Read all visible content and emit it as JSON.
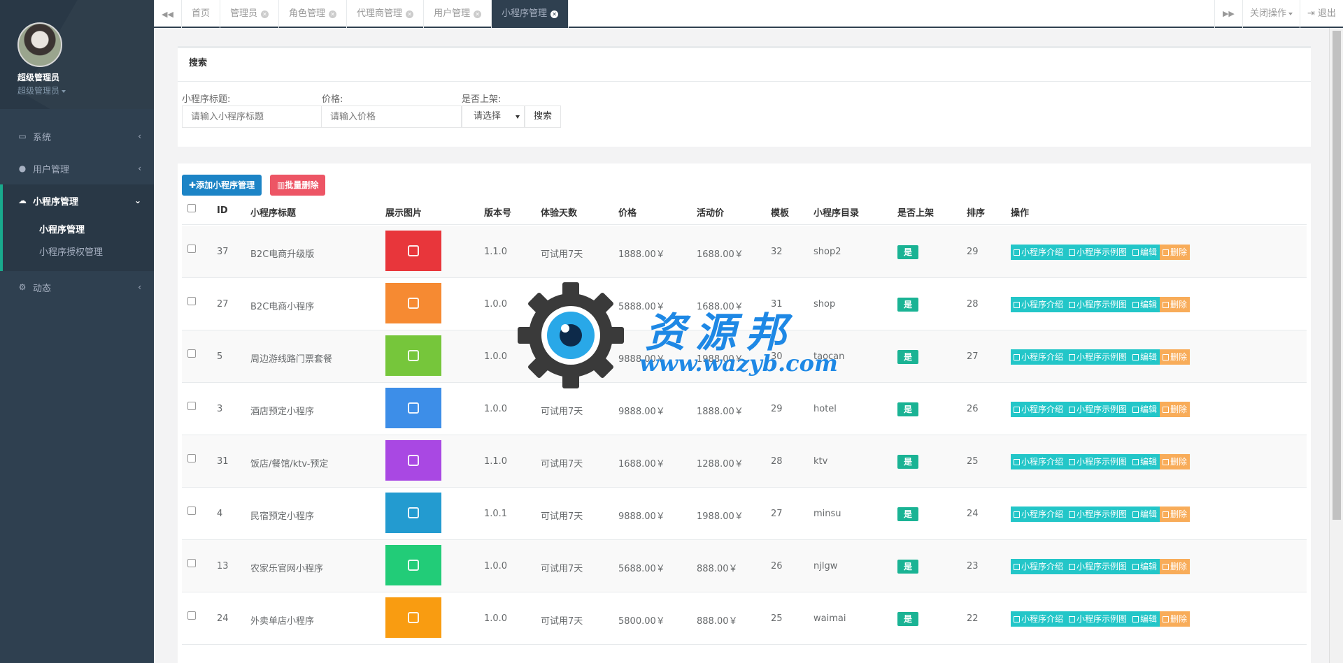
{
  "profile": {
    "name": "超级管理员",
    "role": "超级管理员"
  },
  "sidebar": {
    "items": [
      {
        "label": "系统",
        "icon": "monitor-icon"
      },
      {
        "label": "用户管理",
        "icon": "user-icon"
      },
      {
        "label": "小程序管理",
        "icon": "chat-icon"
      },
      {
        "label": "动态",
        "icon": "gears-icon"
      }
    ],
    "subitems": [
      "小程序管理",
      "小程序授权管理"
    ]
  },
  "tabs": [
    {
      "label": "首页"
    },
    {
      "label": "管理员"
    },
    {
      "label": "角色管理"
    },
    {
      "label": "代理商管理"
    },
    {
      "label": "用户管理"
    },
    {
      "label": "小程序管理"
    }
  ],
  "topbar": {
    "close_ops": "关闭操作",
    "logout": "退出"
  },
  "search": {
    "title": "搜索",
    "title_label": "小程序标题:",
    "title_placeholder": "请输入小程序标题",
    "price_label": "价格:",
    "price_placeholder": "请输入价格",
    "onsale_label": "是否上架:",
    "onsale_selected": "请选择",
    "button": "搜索"
  },
  "toolbar": {
    "add": "添加小程序管理",
    "batch_delete": "批量删除"
  },
  "table": {
    "headers": [
      "ID",
      "小程序标题",
      "展示图片",
      "版本号",
      "体验天数",
      "价格",
      "活动价",
      "模板",
      "小程序目录",
      "是否上架",
      "排序",
      "操作"
    ],
    "actions": [
      "小程序介绍",
      "小程序示例图",
      "编辑",
      "删除"
    ],
    "rows": [
      {
        "id": "37",
        "title": "B2C电商升级版",
        "color": "#e8363b",
        "version": "1.1.0",
        "trial": "可试用7天",
        "price": "1888.00￥",
        "promo": "1688.00￥",
        "template": "32",
        "dir": "shop2",
        "onsale": "是",
        "sort": "29"
      },
      {
        "id": "27",
        "title": "B2C电商小程序",
        "color": "#f68a32",
        "version": "1.0.0",
        "trial": "可试用7天",
        "price": "5888.00￥",
        "promo": "1688.00￥",
        "template": "31",
        "dir": "shop",
        "onsale": "是",
        "sort": "28"
      },
      {
        "id": "5",
        "title": "周边游线路门票套餐",
        "color": "#76c63b",
        "version": "1.0.0",
        "trial": "可试用7天",
        "price": "9888.00￥",
        "promo": "1988.00￥",
        "template": "30",
        "dir": "taocan",
        "onsale": "是",
        "sort": "27"
      },
      {
        "id": "3",
        "title": "酒店预定小程序",
        "color": "#3d8ee8",
        "version": "1.0.0",
        "trial": "可试用7天",
        "price": "9888.00￥",
        "promo": "1888.00￥",
        "template": "29",
        "dir": "hotel",
        "onsale": "是",
        "sort": "26"
      },
      {
        "id": "31",
        "title": "饭店/餐馆/ktv-预定",
        "color": "#a948e3",
        "version": "1.1.0",
        "trial": "可试用7天",
        "price": "1688.00￥",
        "promo": "1288.00￥",
        "template": "28",
        "dir": "ktv",
        "onsale": "是",
        "sort": "25"
      },
      {
        "id": "4",
        "title": "民宿预定小程序",
        "color": "#239bd0",
        "version": "1.0.1",
        "trial": "可试用7天",
        "price": "9888.00￥",
        "promo": "1988.00￥",
        "template": "27",
        "dir": "minsu",
        "onsale": "是",
        "sort": "24"
      },
      {
        "id": "13",
        "title": "农家乐官网小程序",
        "color": "#22cc78",
        "version": "1.0.0",
        "trial": "可试用7天",
        "price": "5688.00￥",
        "promo": "888.00￥",
        "template": "26",
        "dir": "njlgw",
        "onsale": "是",
        "sort": "23"
      },
      {
        "id": "24",
        "title": "外卖单店小程序",
        "color": "#f99c11",
        "version": "1.0.0",
        "trial": "可试用7天",
        "price": "5800.00￥",
        "promo": "888.00￥",
        "template": "25",
        "dir": "waimai",
        "onsale": "是",
        "sort": "22"
      }
    ]
  },
  "watermark": {
    "text_cn": "资源邦",
    "text_url": "www.wazyb.com"
  }
}
